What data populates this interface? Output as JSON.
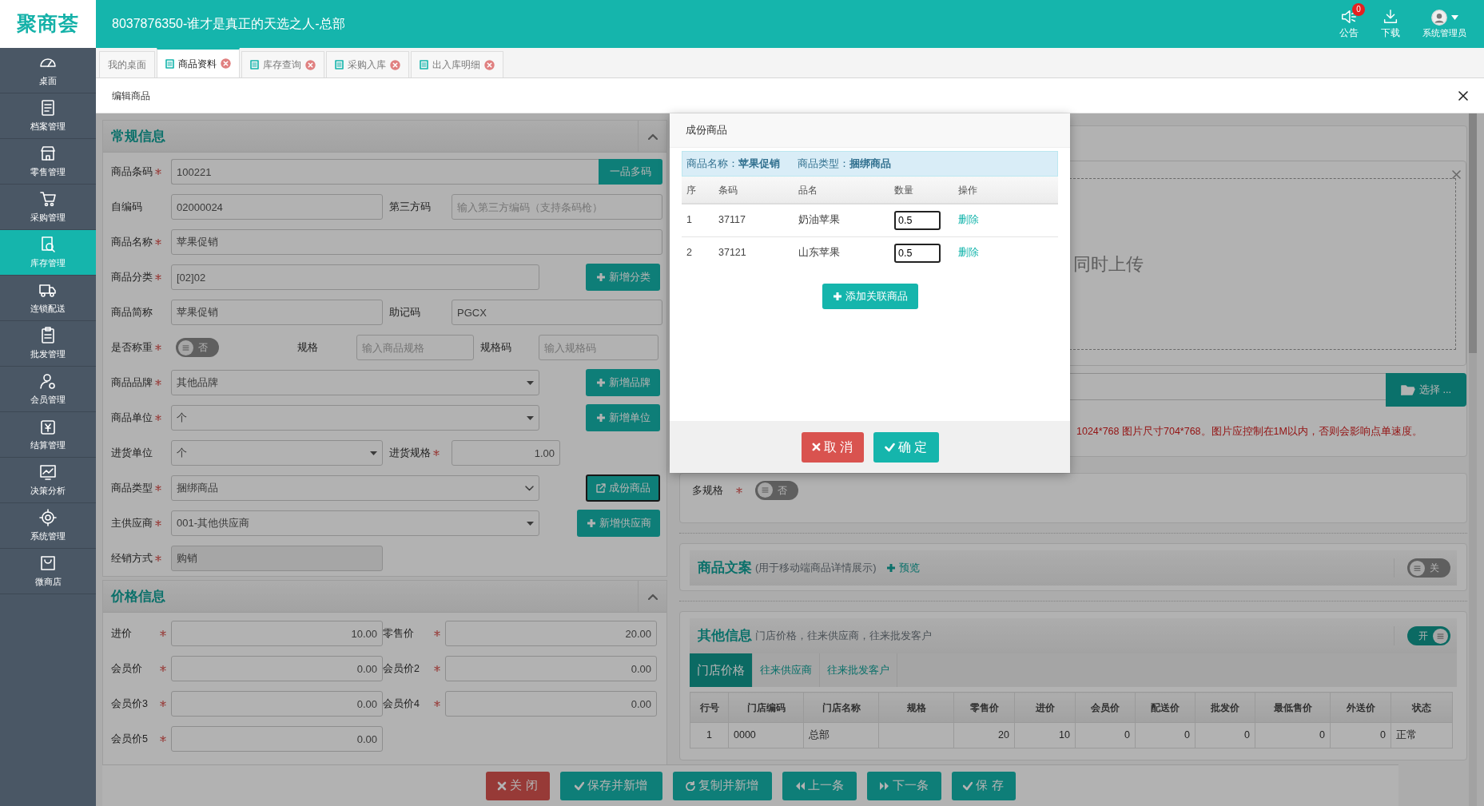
{
  "header": {
    "logo": "聚商荟",
    "title": "8037876350-谁才是真正的天选之人-总部",
    "notice": {
      "label": "公告",
      "badge": "0"
    },
    "download": {
      "label": "下载"
    },
    "user": {
      "label": "系统管理员"
    }
  },
  "sidebar": {
    "items": [
      {
        "label": "桌面",
        "selected": false
      },
      {
        "label": "档案管理",
        "selected": false
      },
      {
        "label": "零售管理",
        "selected": false
      },
      {
        "label": "采购管理",
        "selected": false
      },
      {
        "label": "库存管理",
        "selected": true
      },
      {
        "label": "连锁配送",
        "selected": false
      },
      {
        "label": "批发管理",
        "selected": false
      },
      {
        "label": "会员管理",
        "selected": false
      },
      {
        "label": "结算管理",
        "selected": false
      },
      {
        "label": "决策分析",
        "selected": false
      },
      {
        "label": "系统管理",
        "selected": false
      },
      {
        "label": "微商店",
        "selected": false
      }
    ]
  },
  "tabs": [
    {
      "label": "我的桌面",
      "selected": false,
      "closable": false
    },
    {
      "label": "商品资料",
      "selected": true,
      "closable": true
    },
    {
      "label": "库存查询",
      "selected": false,
      "closable": true
    },
    {
      "label": "采购入库",
      "selected": false,
      "closable": true
    },
    {
      "label": "出入库明细",
      "selected": false,
      "closable": true
    }
  ],
  "panel": {
    "title": "编辑商品"
  },
  "general": {
    "title": "常规信息",
    "rows": [
      [
        {
          "kind": "input",
          "label": "商品条码",
          "required": true,
          "value": "100221"
        },
        {
          "kind": "addon",
          "label": "一品多码"
        }
      ],
      [
        {
          "kind": "input",
          "label": "自编码",
          "required": false,
          "value": "02000024"
        },
        {
          "kind": "input",
          "label": "第三方码",
          "required": false,
          "placeholder": "输入第三方编码（支持条码枪）"
        }
      ],
      [
        {
          "kind": "input",
          "label": "商品名称",
          "required": true,
          "value": "苹果促销"
        }
      ],
      [
        {
          "kind": "input",
          "label": "商品分类",
          "required": true,
          "value": "[02]02"
        },
        {
          "kind": "button",
          "label": "新增分类"
        }
      ],
      [
        {
          "kind": "input",
          "label": "商品简称",
          "required": false,
          "value": "苹果促销"
        },
        {
          "kind": "input",
          "label": "助记码",
          "required": false,
          "value": "PGCX"
        }
      ],
      [
        {
          "kind": "toggle",
          "label": "是否称重",
          "required": true,
          "on": false,
          "text": "否"
        },
        {
          "kind": "input",
          "label": "规格",
          "required": false,
          "placeholder": "输入商品规格"
        },
        {
          "kind": "input",
          "label": "规格码",
          "required": false,
          "placeholder": "输入规格码"
        }
      ],
      [
        {
          "kind": "select",
          "label": "商品品牌",
          "required": true,
          "value": "其他品牌"
        },
        {
          "kind": "button",
          "label": "新增品牌"
        }
      ],
      [
        {
          "kind": "select",
          "label": "商品单位",
          "required": true,
          "value": "个"
        },
        {
          "kind": "button",
          "label": "新增单位"
        }
      ],
      [
        {
          "kind": "select",
          "label": "进货单位",
          "required": false,
          "value": "个"
        },
        {
          "kind": "number",
          "label": "进货规格",
          "required": true,
          "value": "1.00"
        }
      ],
      [
        {
          "kind": "combo",
          "label": "商品类型",
          "required": true,
          "value": "捆绑商品"
        },
        {
          "kind": "outline",
          "label": "成份商品"
        }
      ],
      [
        {
          "kind": "select",
          "label": "主供应商",
          "required": true,
          "value": "001-其他供应商"
        },
        {
          "kind": "button",
          "label": "新增供应商"
        }
      ],
      [
        {
          "kind": "readonly",
          "label": "经销方式",
          "required": true,
          "value": "购销"
        }
      ]
    ]
  },
  "pricing": {
    "title": "价格信息",
    "fields": [
      {
        "label": "进价",
        "required": true,
        "value": "10.00"
      },
      {
        "label": "零售价",
        "required": true,
        "value": "20.00"
      },
      {
        "label": "会员价",
        "required": true,
        "value": "0.00"
      },
      {
        "label": "会员价2",
        "required": true,
        "value": "0.00"
      },
      {
        "label": "会员价3",
        "required": true,
        "value": "0.00"
      },
      {
        "label": "会员价4",
        "required": true,
        "value": "0.00"
      },
      {
        "label": "会员价5",
        "required": true,
        "value": "0.00"
      }
    ]
  },
  "images": {
    "drop_hint": "同时上传",
    "choose_button": "选择 ...",
    "note": "1024*768 图片尺寸704*768。图片应控制在1M以内，否则会影响点单速度。"
  },
  "multi_spec": {
    "label": "多规格",
    "required": true,
    "on": false,
    "text": "否"
  },
  "copywriting": {
    "title": "商品文案",
    "subtitle": "(用于移动端商品详情展示)",
    "preview": "预览",
    "on": false,
    "text": "关"
  },
  "other": {
    "title": "其他信息",
    "subtitle": "门店价格，往来供应商，往来批发客户",
    "on": true,
    "text": "开",
    "tabs": [
      {
        "label": "门店价格",
        "selected": true
      },
      {
        "label": "往来供应商",
        "selected": false
      },
      {
        "label": "往来批发客户",
        "selected": false
      }
    ],
    "table": {
      "columns": [
        "行号",
        "门店编码",
        "门店名称",
        "规格",
        "零售价",
        "进价",
        "会员价",
        "配送价",
        "批发价",
        "最低售价",
        "外送价",
        "状态"
      ],
      "rows": [
        [
          "1",
          "0000",
          "总部",
          "",
          "20",
          "10",
          "0",
          "0",
          "0",
          "0",
          "0",
          "正常"
        ]
      ]
    }
  },
  "footer_buttons": [
    {
      "kind": "close",
      "label": "关 闭"
    },
    {
      "kind": "save-new",
      "label": "保存并新增"
    },
    {
      "kind": "copy",
      "label": "复制并新增"
    },
    {
      "kind": "prev",
      "label": "上一条"
    },
    {
      "kind": "next",
      "label": "下一条"
    },
    {
      "kind": "save",
      "label": "保 存"
    }
  ],
  "dialog": {
    "title": "成份商品",
    "info": [
      {
        "label": "商品名称：",
        "value": "苹果促销"
      },
      {
        "label": "商品类型：",
        "value": "捆绑商品"
      }
    ],
    "columns": [
      "序",
      "条码",
      "品名",
      "数量",
      "操作"
    ],
    "rows": [
      {
        "index": "1",
        "code": "37117",
        "name": "奶油苹果",
        "qty": "0.5",
        "action": "删除"
      },
      {
        "index": "2",
        "code": "37121",
        "name": "山东苹果",
        "qty": "0.5",
        "action": "删除"
      }
    ],
    "add_button": "添加关联商品",
    "buttons": [
      {
        "kind": "cancel",
        "label": "取 消"
      },
      {
        "kind": "confirm",
        "label": "确 定"
      }
    ]
  }
}
